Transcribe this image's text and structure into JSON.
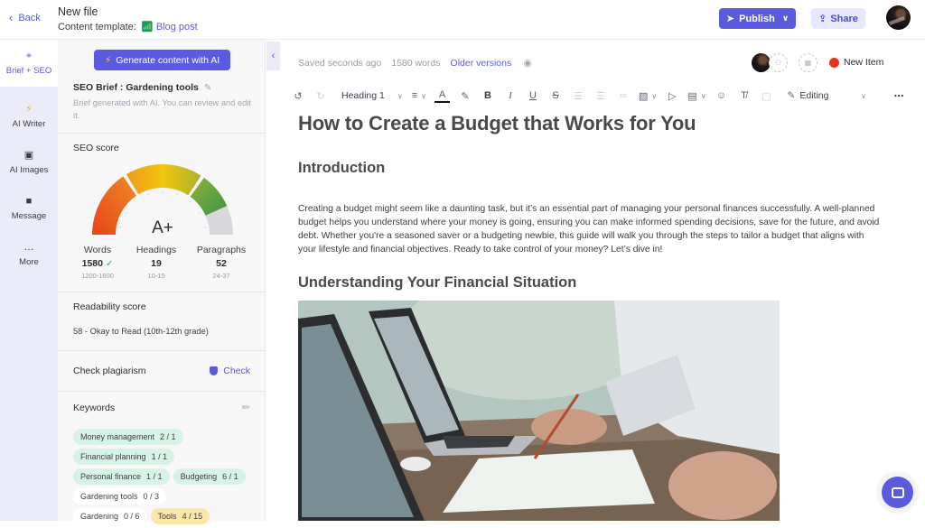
{
  "header": {
    "back_label": "Back",
    "file_title": "New file",
    "template_label": "Content template:",
    "template_name": "Blog post",
    "publish_label": "Publish",
    "share_label": "Share"
  },
  "rail": {
    "items": [
      {
        "label": "Brief + SEO",
        "icon": "target-icon",
        "active": true
      },
      {
        "label": "AI Writer",
        "icon": "bolt-icon"
      },
      {
        "label": "AI Images",
        "icon": "image-icon"
      },
      {
        "label": "Message",
        "icon": "message-icon"
      },
      {
        "label": "More",
        "icon": "more-dots-icon"
      }
    ]
  },
  "brief": {
    "generate_label": "Generate content with AI",
    "title": "SEO Brief : Gardening tools",
    "description": "Brief generated with AI. You can review and edit it.",
    "seo_score_title": "SEO score",
    "grade": "A+",
    "gauge_colors": [
      "#e8471c",
      "#f0b10e",
      "#4f9a3c",
      "#d8d8dc"
    ],
    "stats": [
      {
        "label": "Words",
        "value": "1580",
        "range": "1200-1800",
        "ok": true
      },
      {
        "label": "Headings",
        "value": "19",
        "range": "10-15"
      },
      {
        "label": "Paragraphs",
        "value": "52",
        "range": "24-37"
      }
    ],
    "readability_title": "Readability score",
    "readability_value": "58 - Okay to Read (10th-12th grade)",
    "plagiarism_title": "Check plagiarism",
    "check_label": "Check",
    "keywords_title": "Keywords",
    "keywords": [
      {
        "term": "Money management",
        "count": "2 / 1",
        "state": "ok"
      },
      {
        "term": "Financial planning",
        "count": "1 / 1",
        "state": "ok"
      },
      {
        "term": "Personal finance",
        "count": "1 / 1",
        "state": "ok"
      },
      {
        "term": "Budgeting",
        "count": "6 / 1",
        "state": "ok"
      },
      {
        "term": "Gardening tools",
        "count": "0 / 3",
        "state": "none"
      },
      {
        "term": "Gardening",
        "count": "0 / 6",
        "state": "none"
      },
      {
        "term": "Tools",
        "count": "4 / 15",
        "state": "over"
      }
    ]
  },
  "editor": {
    "saved_status": "Saved seconds ago",
    "word_count": "1580 words",
    "older_versions": "Older versions",
    "status_label": "New Item",
    "status_color": "#e8311f",
    "toolbar": {
      "block_type": "Heading 1",
      "mode": "Editing"
    },
    "doc": {
      "title": "How to Create a Budget that Works for You",
      "h2_intro": "Introduction",
      "intro_paragraph": "Creating a budget might seem like a daunting task, but it’s an essential part of managing your personal finances successfully. A well-planned budget helps you understand where your money is going, ensuring you can make informed spending decisions, save for the future, and avoid debt. Whether you're a seasoned saver or a budgeting newbie, this guide will walk you through the steps to tailor a budget that aligns with your lifestyle and financial objectives. Ready to take control of your money? Let’s dive in!",
      "h2_section": "Understanding Your Financial Situation",
      "image_alt": "People working with laptops and financial paperwork at a desk"
    }
  }
}
